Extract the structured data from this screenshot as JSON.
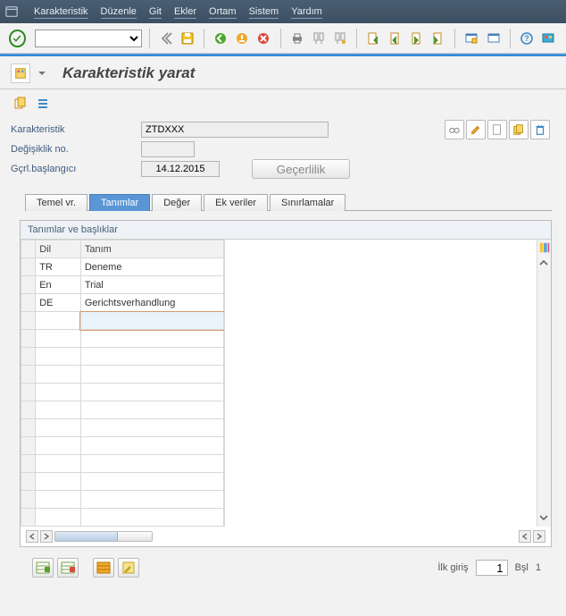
{
  "menu": {
    "items": [
      "Karakteristik",
      "Düzenle",
      "Git",
      "Ekler",
      "Ortam",
      "Sistem",
      "Yardım"
    ]
  },
  "page": {
    "title": "Karakteristik yarat"
  },
  "form": {
    "char_label": "Karakteristik",
    "char_value": "ZTDXXX",
    "change_label": "Değişiklik no.",
    "change_value": "",
    "valid_label": "Gçrl.başlangıcı",
    "valid_value": "14.12.2015",
    "validity_button": "Geçerlilik"
  },
  "tabs": {
    "items": [
      "Temel vr.",
      "Tanımlar",
      "Değer",
      "Ek veriler",
      "Sınırlamalar"
    ],
    "active_index": 1
  },
  "table": {
    "caption": "Tanımlar ve başlıklar",
    "col_lang": "Dil",
    "col_desc": "Tanım",
    "rows": [
      {
        "lang": "TR",
        "desc": "Deneme"
      },
      {
        "lang": "En",
        "desc": "Trial"
      },
      {
        "lang": "DE",
        "desc": "Gerichtsverhandlung"
      }
    ],
    "empty_rows": 12
  },
  "footer": {
    "first_entry_label": "İlk giriş",
    "first_entry_value": "1",
    "of_label": "Bşl",
    "of_value": "1"
  },
  "colors": {
    "accent": "#5a95d6",
    "menubar": "#3d4f61"
  }
}
